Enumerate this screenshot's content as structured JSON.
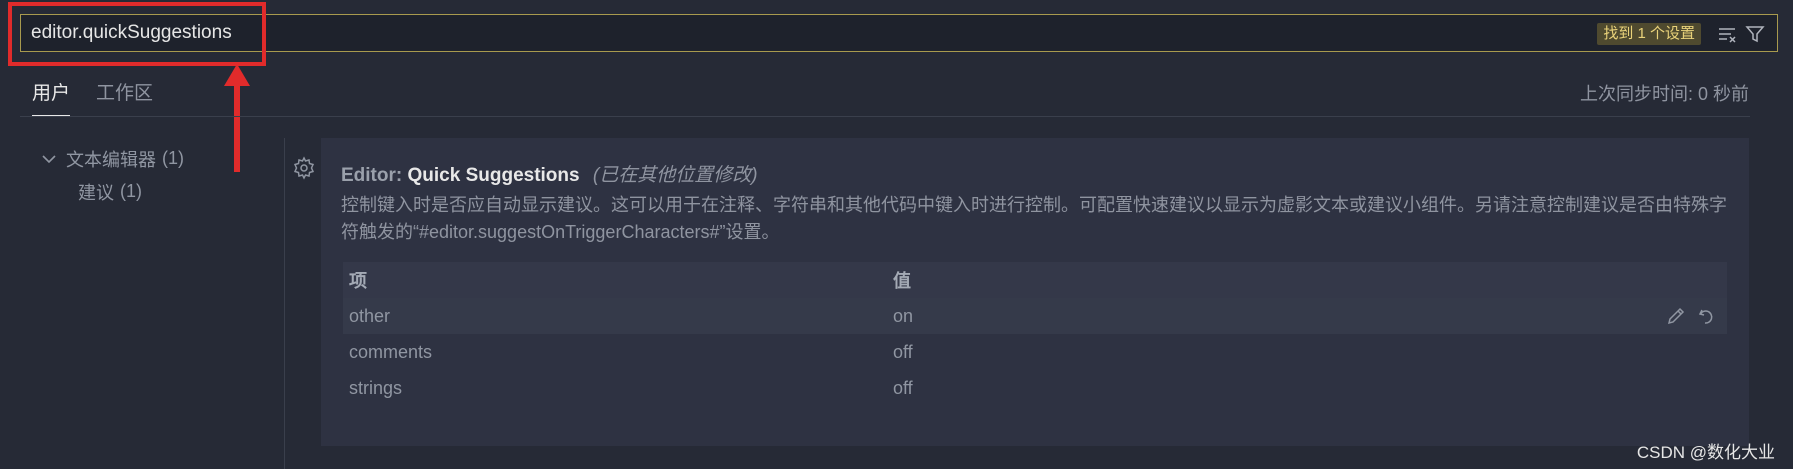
{
  "search": {
    "value": "editor.quickSuggestions",
    "found_label": "找到 1 个设置"
  },
  "tabs": [
    {
      "label": "用户",
      "active": true
    },
    {
      "label": "工作区",
      "active": false
    }
  ],
  "sync_status": "上次同步时间: 0 秒前",
  "tree": {
    "group": {
      "label": "文本编辑器",
      "count": "(1)"
    },
    "child": {
      "label": "建议",
      "count": "(1)"
    }
  },
  "setting": {
    "category": "Editor:",
    "name": "Quick Suggestions",
    "modified_note": "(已在其他位置修改)",
    "description": "控制键入时是否应自动显示建议。这可以用于在注释、字符串和其他代码中键入时进行控制。可配置快速建议以显示为虚影文本或建议小组件。另请注意控制建议是否由特殊字符触发的“#editor.suggestOnTriggerCharacters#”设置。",
    "table": {
      "header_key": "项",
      "header_value": "值",
      "rows": [
        {
          "key": "other",
          "value": "on"
        },
        {
          "key": "comments",
          "value": "off"
        },
        {
          "key": "strings",
          "value": "off"
        }
      ]
    }
  },
  "watermark": "CSDN @数化大业",
  "colors": {
    "accent_border": "#a89a4e",
    "badge_bg": "#4f4a2f",
    "badge_text": "#e9d27a",
    "annotation_red": "#e12b2b"
  },
  "icons": [
    "clear-filter-icon",
    "filter-icon",
    "chevron-down-icon",
    "gear-icon",
    "edit-pencil-icon",
    "reset-icon"
  ]
}
